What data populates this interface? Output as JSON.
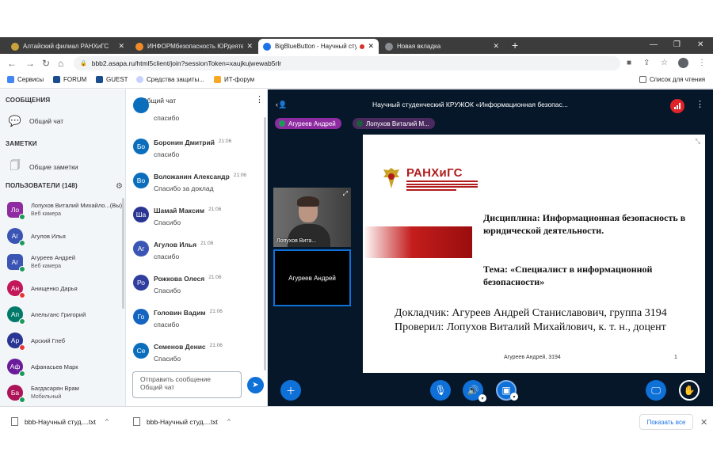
{
  "browser": {
    "tabs": [
      {
        "title": "Алтайский филиал РАНХиГС",
        "active": false,
        "fav_color": "#c8a33a"
      },
      {
        "title": "ИНФОРМбезопасность ЮРдеятельн",
        "active": false,
        "fav_color": "#f28c28"
      },
      {
        "title": "BigBlueButton - Научный студ",
        "active": true,
        "fav_color": "#1a73e8"
      },
      {
        "title": "Новая вкладка",
        "active": false,
        "fav_color": "#8a8d91"
      }
    ],
    "new_tab": "+",
    "url": "bbb2.asapa.ru/html5client/join?sessionToken=xaujkujwewab5rlr",
    "bookmarks": [
      {
        "label": "Сервисы",
        "color": "#4285f4"
      },
      {
        "label": "FORUM",
        "color": "#1a4d8f"
      },
      {
        "label": "GUEST",
        "color": "#1a4d8f"
      },
      {
        "label": "Средства защиты...",
        "color": "#c7d2fe"
      },
      {
        "label": "ИТ-форум",
        "color": "#f9a825"
      }
    ],
    "reading_list": "Список для чтения"
  },
  "sidebar": {
    "messages_title": "СООБЩЕНИЯ",
    "public_chat": "Общий чат",
    "notes_title": "ЗАМЕТКИ",
    "shared_notes": "Общие заметки",
    "users_title": "ПОЛЬЗОВАТЕЛИ (148)",
    "users": [
      {
        "initials": "Ло",
        "name": "Лопухов Виталий Михайло...(Вы)",
        "sub": "Веб камера",
        "color": "#8e2ba0",
        "status": "#1b9a59",
        "round": false
      },
      {
        "initials": "Аг",
        "name": "Агулов Илья",
        "sub": "",
        "color": "#3a55b4",
        "status": "#1b9a59",
        "round": true
      },
      {
        "initials": "Аг",
        "name": "Агуреев Андрей",
        "sub": "Веб камера",
        "color": "#3a55b4",
        "status": "#1b9a59",
        "round": false
      },
      {
        "initials": "Ан",
        "name": "Анищенко Дарья",
        "sub": "",
        "color": "#c2185b",
        "status": "#e53935",
        "round": true
      },
      {
        "initials": "Ап",
        "name": "Апельганс Григорий",
        "sub": "",
        "color": "#00796b",
        "status": "#1b9a59",
        "round": true
      },
      {
        "initials": "Ар",
        "name": "Арский Глеб",
        "sub": "",
        "color": "#283593",
        "status": "#e53935",
        "round": true
      },
      {
        "initials": "Аф",
        "name": "Афанасьев Марк",
        "sub": "",
        "color": "#6a1b9a",
        "status": "#1b9a59",
        "round": true
      },
      {
        "initials": "Ба",
        "name": "Багдасарян Врам",
        "sub": "Мобильный",
        "color": "#ad1457",
        "status": "#1b9a59",
        "round": true
      }
    ]
  },
  "chat": {
    "back_label": "Общий чат",
    "partial_text": "спасибо",
    "messages": [
      {
        "initials": "Бо",
        "color": "#0a6ebd",
        "name": "Боронин Дмитрий",
        "time": "21:06",
        "text": "спасибо"
      },
      {
        "initials": "Во",
        "color": "#0a6ebd",
        "name": "Воложанин Александр",
        "time": "21:06",
        "text": "Спасибо за доклад"
      },
      {
        "initials": "Ша",
        "color": "#283593",
        "name": "Шамай Максим",
        "time": "21:06",
        "text": "Спасибо"
      },
      {
        "initials": "Аг",
        "color": "#3a55b4",
        "name": "Агулов Илья",
        "time": "21:06",
        "text": "спасибо"
      },
      {
        "initials": "Ро",
        "color": "#303f9f",
        "name": "Рожкова Олеся",
        "time": "21:06",
        "text": "Спасибо"
      },
      {
        "initials": "Го",
        "color": "#1565c0",
        "name": "Головин Вадим",
        "time": "21:06",
        "text": "спасибо"
      },
      {
        "initials": "Се",
        "color": "#0a6ebd",
        "name": "Семенов Денис",
        "time": "21:06",
        "text": "Спасибо"
      }
    ],
    "input_placeholder": "Отправить сообщение Общий чат"
  },
  "main": {
    "title": "Научный студенческий КРУЖОК «Информационная безопас...",
    "talkers": [
      {
        "name": "Агуреев Андрей",
        "color": "#8e2ba0",
        "mic": "#1b9a59"
      },
      {
        "name": "Лопухов Виталий М...",
        "color": "#4a2a5e",
        "mic": "#1b5e3a"
      }
    ],
    "video1_label": "Лопухов Вита...",
    "video2_label": "Агуреев Андрей",
    "slide": {
      "logo": "РАНХиГС",
      "discipline": "Дисциплина: Информационная безопасность в юридической деятельности.",
      "topic": "Тема: «Специалист в информационной безопасности»",
      "speaker": "Докладчик: Агуреев Андрей Станиславович, группа 3194",
      "checker": "Проверил: Лопухов Виталий Михайлович, к. т. н., доцент",
      "footer_name": "Агуреев Андрей, 3194",
      "page_number": "1"
    }
  },
  "downloads": {
    "items": [
      {
        "name": "bbb-Научный студ....txt"
      },
      {
        "name": "bbb-Научный студ....txt"
      }
    ],
    "show_all": "Показать все"
  },
  "colors": {
    "bbb_blue": "#0f70d7",
    "main_bg": "#06172a",
    "accent_red": "#c41d1d"
  }
}
